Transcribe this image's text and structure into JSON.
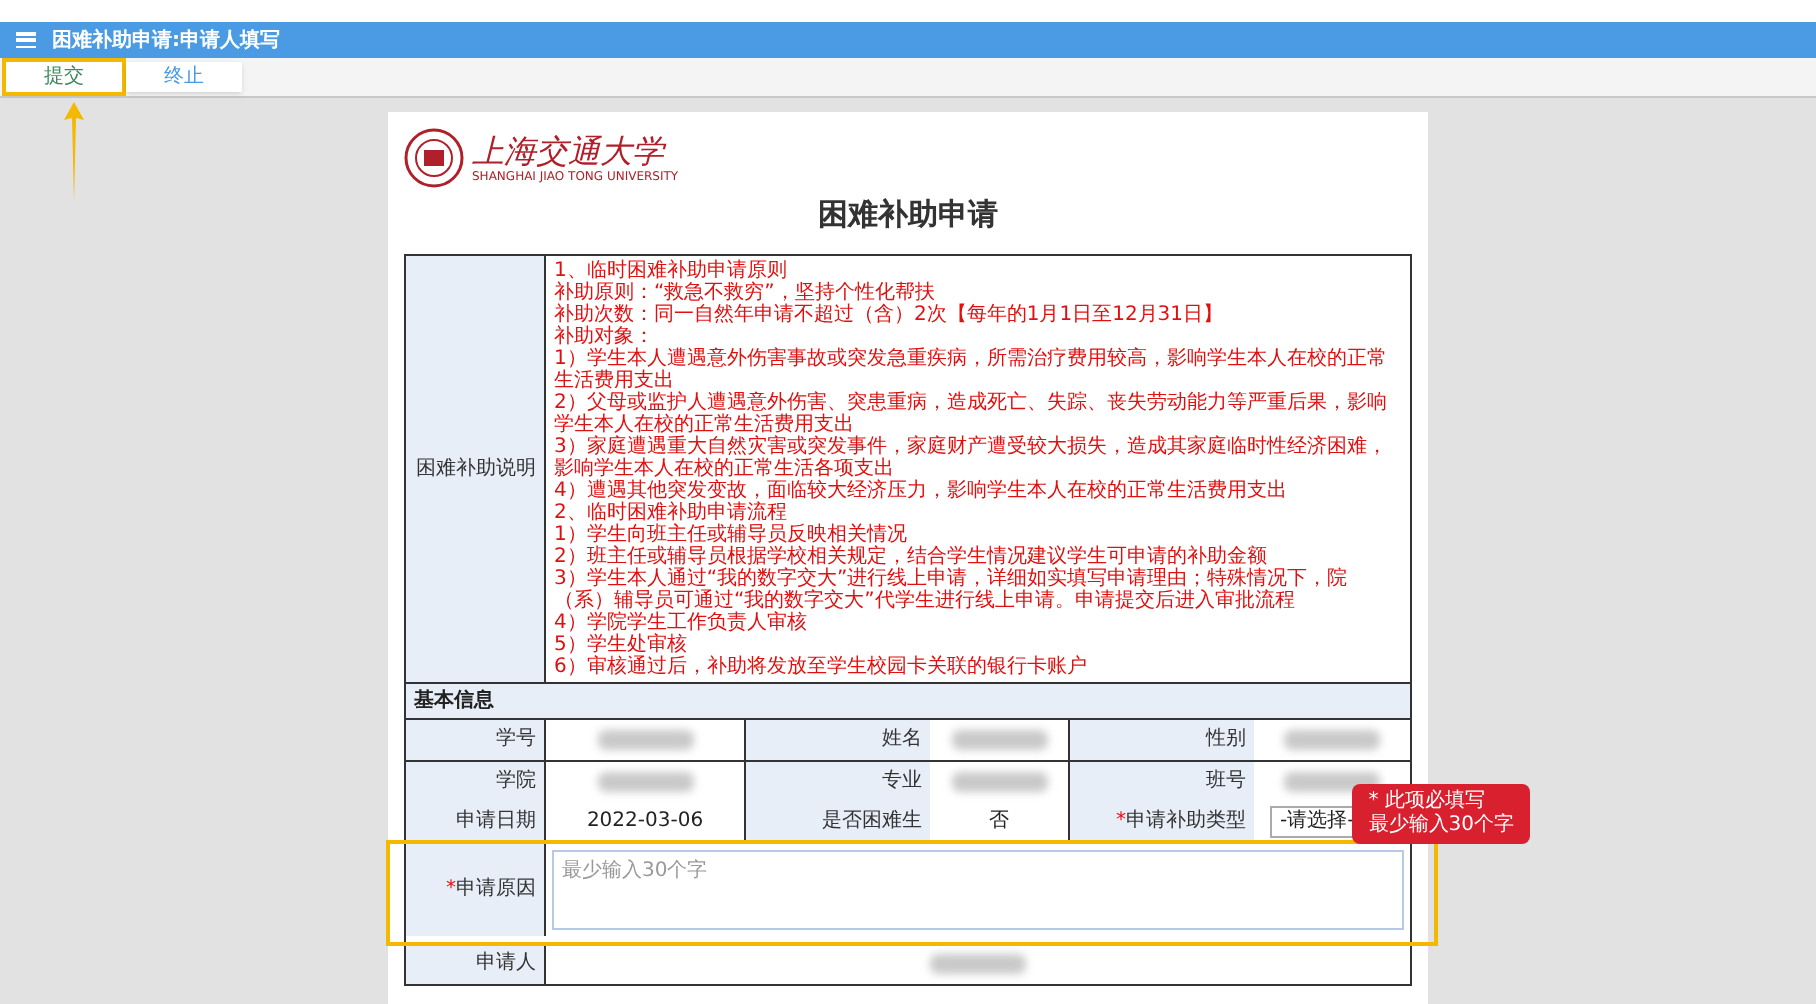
{
  "header": {
    "title": "困难补助申请:申请人填写"
  },
  "toolbar": {
    "buttons": [
      {
        "label": "提交",
        "highlighted": true
      },
      {
        "label": "终止",
        "highlighted": false
      }
    ]
  },
  "document": {
    "logo": {
      "name": "上海交通大学",
      "subtitle": "SHANGHAI JIAO TONG UNIVERSITY"
    },
    "title": "困难补助申请",
    "instructions": {
      "label": "困难补助说明",
      "lines": [
        "1、临时困难补助申请原则",
        "补助原则：“救急不救穷”，坚持个性化帮扶",
        "补助次数：同一自然年申请不超过（含）2次【每年的1月1日至12月31日】",
        "补助对象：",
        "1）学生本人遭遇意外伤害事故或突发急重疾病，所需治疗费用较高，影响学生本人在校的正常生活费用支出",
        "2）父母或监护人遭遇意外伤害、突患重病，造成死亡、失踪、丧失劳动能力等严重后果，影响学生本人在校的正常生活费用支出",
        "3）家庭遭遇重大自然灾害或突发事件，家庭财产遭受较大损失，造成其家庭临时性经济困难，影响学生本人在校的正常生活各项支出",
        "4）遭遇其他突发变故，面临较大经济压力，影响学生本人在校的正常生活费用支出",
        "2、临时困难补助申请流程",
        "1）学生向班主任或辅导员反映相关情况",
        "2）班主任或辅导员根据学校相关规定，结合学生情况建议学生可申请的补助金额",
        "3）学生本人通过“我的数字交大”进行线上申请，详细如实填写申请理由；特殊情况下，院（系）辅导员可通过“我的数字交大”代学生进行线上申请。申请提交后进入审批流程",
        "4）学院学生工作负责人审核",
        "5）学生处审核",
        "6）审核通过后，补助将发放至学生校园卡关联的银行卡账户"
      ]
    },
    "basic_info": {
      "heading": "基本信息",
      "rows": [
        [
          {
            "label": "学号",
            "kind": "blurred"
          },
          {
            "label": "姓名",
            "kind": "blurred"
          },
          {
            "label": "性别",
            "kind": "blurred"
          }
        ],
        [
          {
            "label": "学院",
            "kind": "blurred"
          },
          {
            "label": "专业",
            "kind": "blurred"
          },
          {
            "label": "班号",
            "kind": "blurred"
          }
        ],
        [
          {
            "label": "申请日期",
            "kind": "text",
            "value": "2022-03-06"
          },
          {
            "label": "是否困难生",
            "kind": "text",
            "value": "否"
          },
          {
            "label": "申请补助类型",
            "kind": "select",
            "required_mark": "*",
            "value": "-请选择-"
          }
        ]
      ]
    },
    "reason": {
      "label": "申请原因",
      "required_mark": "*",
      "placeholder": "最少输入30个字",
      "highlighted": true,
      "error": [
        "* 此项必填写",
        "最少输入30个字"
      ]
    },
    "applicant": {
      "label": "申请人",
      "kind": "blurred"
    }
  }
}
